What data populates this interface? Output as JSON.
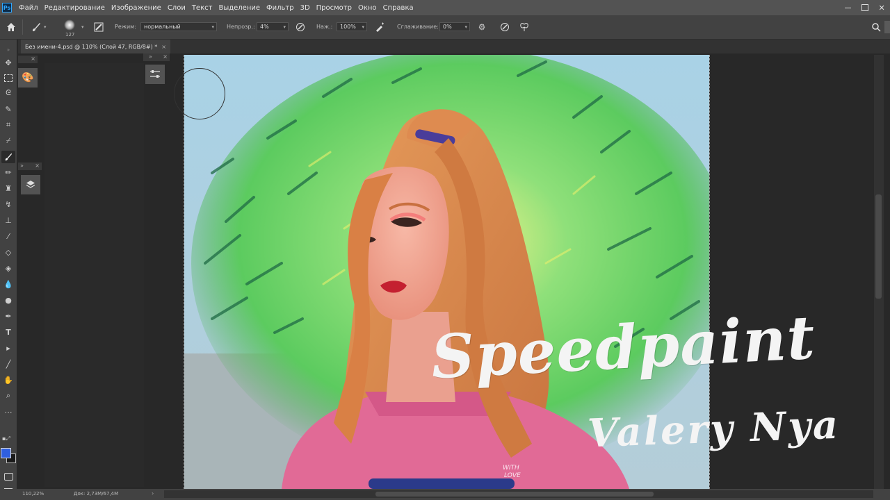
{
  "app": {
    "logo_text": "Ps",
    "menu": [
      "Файл",
      "Редактирование",
      "Изображение",
      "Слои",
      "Текст",
      "Выделение",
      "Фильтр",
      "3D",
      "Просмотр",
      "Окно",
      "Справка"
    ]
  },
  "options": {
    "brush_size": "127",
    "mode_label": "Режим:",
    "mode_value": "нормальный",
    "opacity_label": "Непрозр.:",
    "opacity_value": "4%",
    "pressure_label": "Наж.:",
    "pressure_value": "100%",
    "smoothing_label": "Сглаживание:",
    "smoothing_value": "0%"
  },
  "document": {
    "tab_title": "Без имени-4.psd @ 110% (Слой 47, RGB/8#) *",
    "close": "×"
  },
  "status": {
    "zoom": "110,22%",
    "doc_info": "Док: 2,73M/67,4M"
  },
  "overlay": {
    "title": "Speedpaint",
    "author": "Valery Nya"
  },
  "artwork": {
    "shirt_text_1": "WITH",
    "shirt_text_2": "LOVE"
  },
  "colors": {
    "foreground": "#2f5fe0",
    "background": "#1a1a1a",
    "sky": "#a9cfe0",
    "foliage": "#6fd66a",
    "hair": "#d9894e",
    "shirt": "#e16a96"
  }
}
